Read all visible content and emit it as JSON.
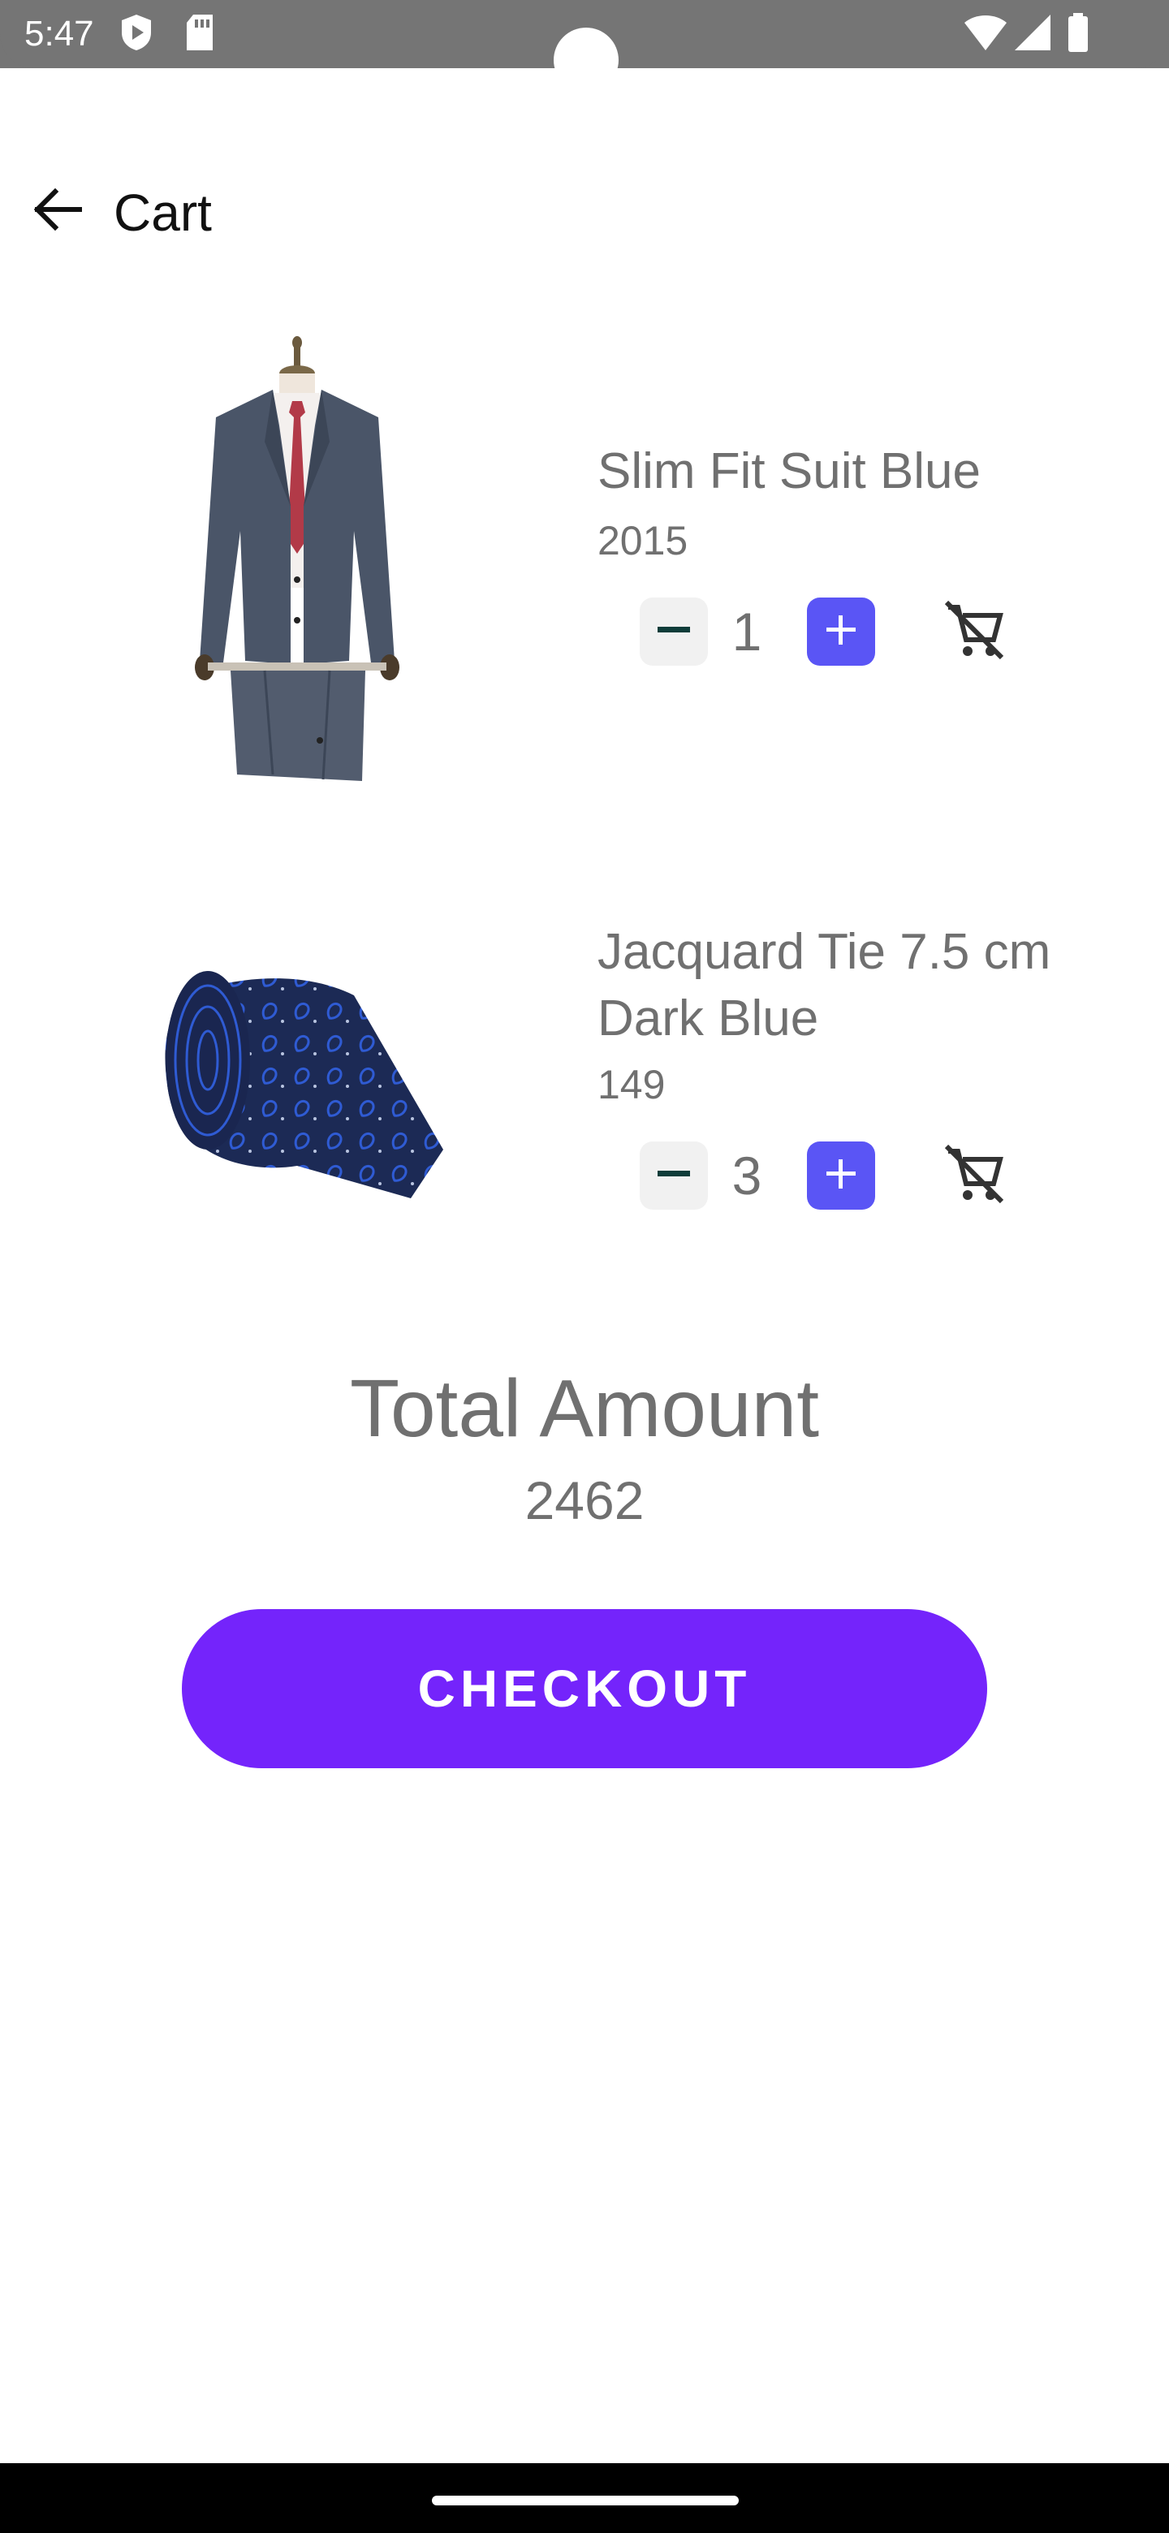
{
  "status_bar": {
    "time": "5:47",
    "icons": [
      "shield-play-icon",
      "sd-card-icon",
      "wifi-icon",
      "signal-icon",
      "battery-icon"
    ]
  },
  "app_bar": {
    "title": "Cart",
    "back_icon": "arrow-back-icon"
  },
  "cart": {
    "items": [
      {
        "name": "Slim Fit Suit Blue",
        "price": "2015",
        "quantity": "1",
        "image": "suit-image"
      },
      {
        "name": "Jacquard Tie 7.5 cm Dark Blue",
        "price": "149",
        "quantity": "3",
        "image": "tie-image"
      }
    ]
  },
  "total": {
    "label": "Total Amount",
    "value": "2462"
  },
  "checkout": {
    "label": "CHECKOUT"
  },
  "colors": {
    "accent": "#7424fb",
    "plus_button": "#5a55f5",
    "text_secondary": "#707070",
    "status_bar": "#757575"
  }
}
